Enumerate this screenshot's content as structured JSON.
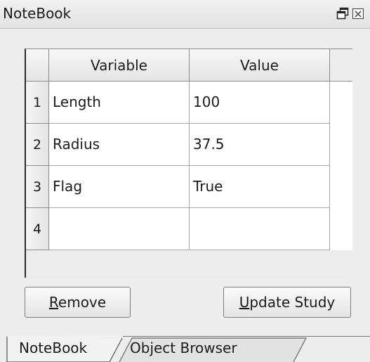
{
  "window": {
    "title": "NoteBook",
    "controls": [
      "float-icon",
      "close-icon"
    ]
  },
  "table": {
    "columns": [
      "Variable",
      "Value"
    ],
    "rows": [
      {
        "num": "1",
        "variable": "Length",
        "value": "100"
      },
      {
        "num": "2",
        "variable": "Radius",
        "value": "37.5"
      },
      {
        "num": "3",
        "variable": "Flag",
        "value": "True"
      },
      {
        "num": "4",
        "variable": "",
        "value": ""
      }
    ]
  },
  "buttons": {
    "remove": {
      "mnemonic": "R",
      "rest": "emove"
    },
    "update": {
      "mnemonic": "U",
      "rest": "pdate Study"
    }
  },
  "tabs": [
    {
      "label": "NoteBook",
      "active": true
    },
    {
      "label": "Object Browser",
      "active": false
    }
  ]
}
